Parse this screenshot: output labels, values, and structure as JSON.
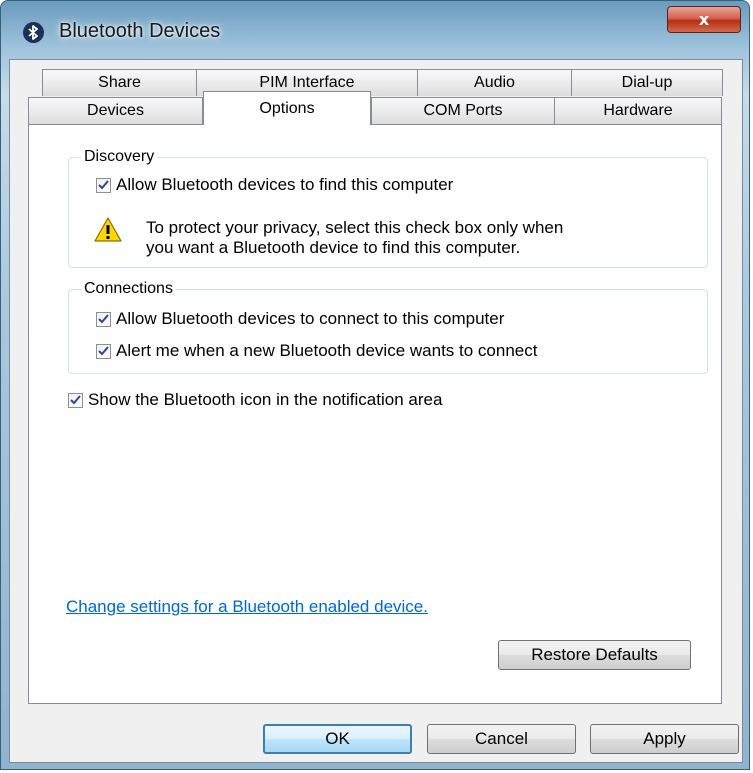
{
  "window": {
    "title": "Bluetooth Devices",
    "close_label": "x"
  },
  "tabs": {
    "back_row": [
      "Share",
      "PIM Interface",
      "Audio",
      "Dial-up"
    ],
    "front_row": [
      "Devices",
      "Options",
      "COM Ports",
      "Hardware"
    ],
    "active": "Options"
  },
  "discovery": {
    "title": "Discovery",
    "allow_find_label": "Allow Bluetooth devices to find this computer",
    "allow_find_checked": true,
    "warning_line1": "To protect your privacy, select this check box only when",
    "warning_line2": "you want a Bluetooth device to find this computer."
  },
  "connections": {
    "title": "Connections",
    "allow_connect_label": "Allow Bluetooth devices to connect to this computer",
    "allow_connect_checked": true,
    "alert_label": "Alert me when a new Bluetooth device wants to connect",
    "alert_checked": true
  },
  "show_icon": {
    "label": "Show the Bluetooth icon in the notification area",
    "checked": true
  },
  "link_text": "Change settings for a Bluetooth enabled device.",
  "buttons": {
    "restore_defaults": "Restore Defaults",
    "ok": "OK",
    "cancel": "Cancel",
    "apply": "Apply"
  },
  "icons": {
    "title_icon": "bluetooth-icon",
    "warning": "warning-icon",
    "check": "checkmark-icon"
  },
  "colors": {
    "link": "#0066cc",
    "frame": "#8fb4cf",
    "close_button": "#c94a30",
    "warning": "#ffd700"
  }
}
